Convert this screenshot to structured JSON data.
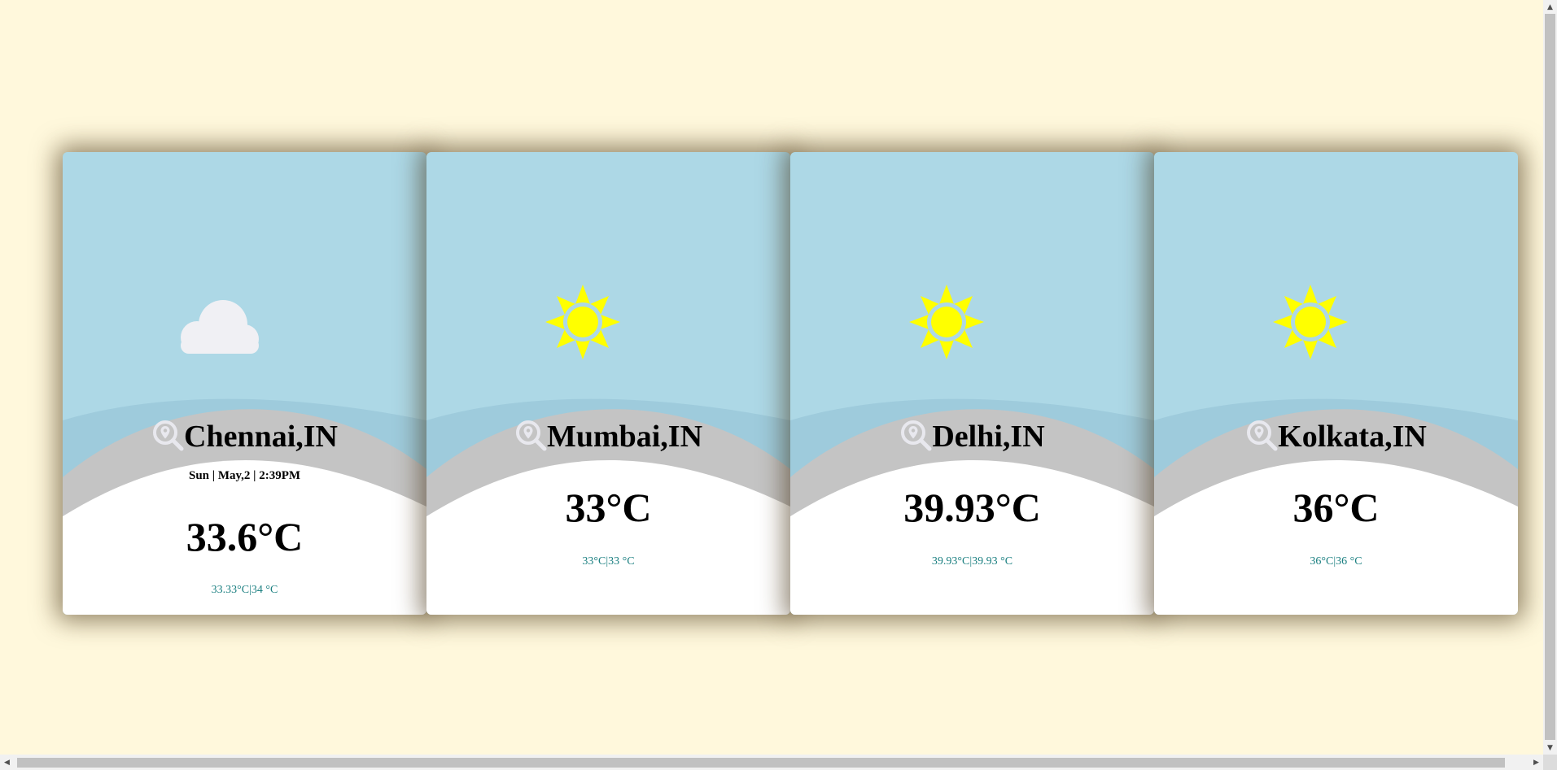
{
  "cards": [
    {
      "city": "Chennai,IN",
      "date": "Sun | May,2 | 2:39PM",
      "temp": "33.6°C",
      "minmax": "33.33°C|34 °C",
      "icon": "cloud-icon"
    },
    {
      "city": "Mumbai,IN",
      "temp": "33°C",
      "minmax": "33°C|33 °C",
      "icon": "sun-icon"
    },
    {
      "city": "Delhi,IN",
      "temp": "39.93°C",
      "minmax": "39.93°C|39.93 °C",
      "icon": "sun-icon"
    },
    {
      "city": "Kolkata,IN",
      "temp": "36°C",
      "minmax": "36°C|36 °C",
      "icon": "sun-icon"
    }
  ],
  "colors": {
    "background": "#fff8dc",
    "sky": "#add8e6",
    "wave_light": "#9ecbdc",
    "wave_gray": "#c4c4c4",
    "ground": "#ffffff",
    "sun": "#ffff00",
    "cloud": "#f0f0f4",
    "minmax_text": "#1a7f80"
  },
  "scrollbar": {
    "up_arrow": "▲",
    "down_arrow": "▼",
    "left_arrow": "◀",
    "right_arrow": "▶"
  }
}
